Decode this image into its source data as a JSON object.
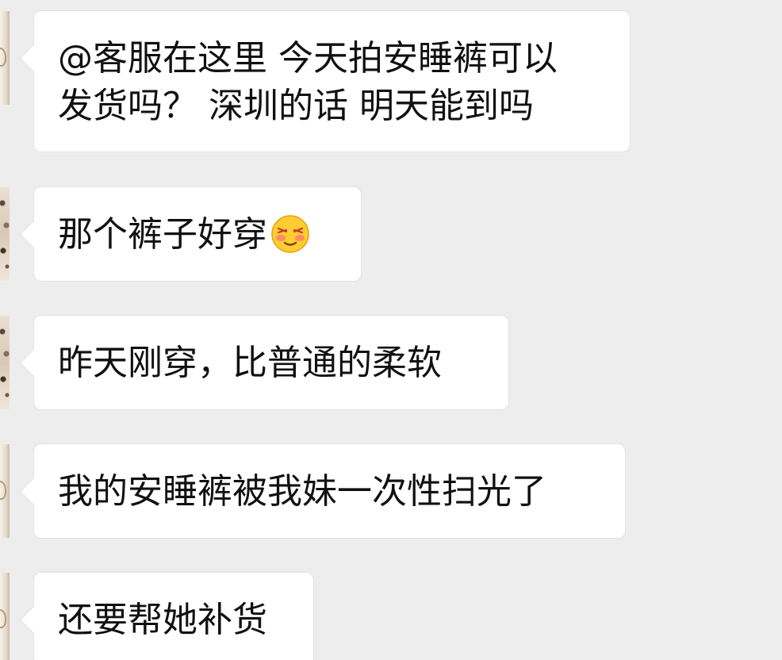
{
  "messages": [
    {
      "lines": [
        "@客服在这里 今天拍安睡裤可以",
        "发货吗？ 深圳的话 明天能到吗"
      ],
      "avatar": "light"
    },
    {
      "lines": [
        "那个裤子好穿"
      ],
      "emoji": "blushing-face-icon",
      "avatar": "dark"
    },
    {
      "lines": [
        "昨天刚穿，比普通的柔软"
      ],
      "avatar": "dark"
    },
    {
      "lines": [
        "我的安睡裤被我妹一次性扫光了"
      ],
      "avatar": "light"
    },
    {
      "lines": [
        "还要帮她补货"
      ],
      "avatar": "light"
    }
  ],
  "colors": {
    "background": "#ededed",
    "bubble": "#ffffff",
    "text": "#111111"
  }
}
